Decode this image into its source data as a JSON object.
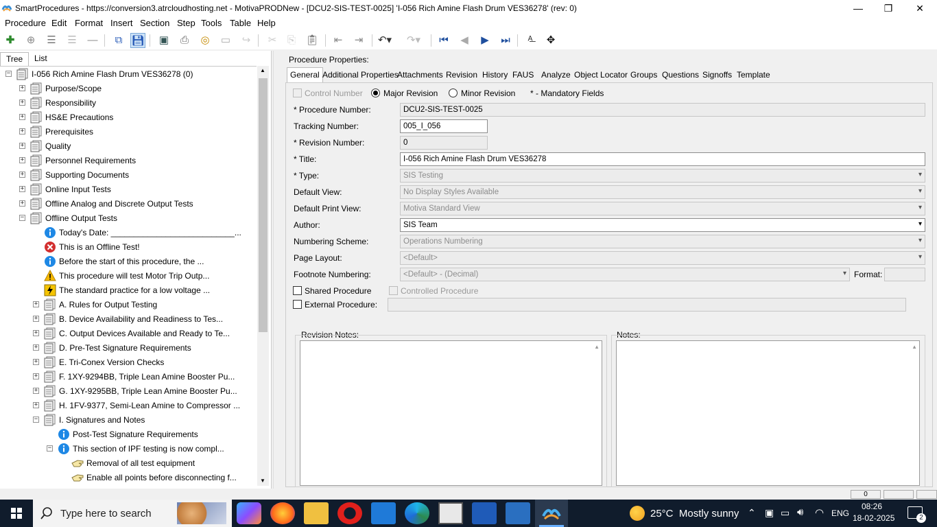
{
  "window": {
    "title": "SmartProcedures - https://conversion3.atrcloudhosting.net - MotivaPRODNew - [DCU2-SIS-TEST-0025] 'I-056 Rich Amine Flash Drum VES36278' (rev: 0)",
    "minimize": "—",
    "restore": "❐",
    "close": "✕"
  },
  "menu": [
    "Procedure",
    "Edit",
    "Format",
    "Insert",
    "Section",
    "Step",
    "Tools",
    "Table",
    "Help"
  ],
  "toolbar_icons": [
    "add-icon",
    "add-child-icon",
    "indent-icon",
    "outdent-icon",
    "remove-icon",
    "copy-file-icon",
    "save-icon",
    "monitor-icon",
    "print-icon",
    "globe-icon",
    "preview-icon",
    "redo-icon",
    "cut-icon",
    "copy-icon",
    "paste-icon",
    "indent-left-icon",
    "indent-right-icon",
    "undo-icon",
    "redo-icon",
    "first-icon",
    "prev-icon",
    "next-icon",
    "last-icon",
    "spell-icon",
    "move-icon"
  ],
  "left_tabs": [
    "Tree",
    "List"
  ],
  "tree": [
    {
      "label": "I-056 Rich Amine Flash Drum VES36278 (0)",
      "level": 0,
      "pm": "−",
      "icon": "doc-icon"
    },
    {
      "label": "Purpose/Scope",
      "level": 1,
      "pm": "+",
      "icon": "doc-icon"
    },
    {
      "label": "Responsibility",
      "level": 1,
      "pm": "+",
      "icon": "doc-icon"
    },
    {
      "label": "HS&E Precautions",
      "level": 1,
      "pm": "+",
      "icon": "doc-icon"
    },
    {
      "label": "Prerequisites",
      "level": 1,
      "pm": "+",
      "icon": "doc-icon"
    },
    {
      "label": "Quality",
      "level": 1,
      "pm": "+",
      "icon": "doc-icon"
    },
    {
      "label": "Personnel Requirements",
      "level": 1,
      "pm": "+",
      "icon": "doc-icon"
    },
    {
      "label": "Supporting Documents",
      "level": 1,
      "pm": "+",
      "icon": "doc-icon"
    },
    {
      "label": "Online Input Tests",
      "level": 1,
      "pm": "+",
      "icon": "doc-icon"
    },
    {
      "label": "Offline Analog and Discrete Output Tests",
      "level": 1,
      "pm": "+",
      "icon": "doc-icon"
    },
    {
      "label": "Offline Output Tests",
      "level": 1,
      "pm": "−",
      "icon": "doc-icon"
    },
    {
      "label": "Today's Date: ___________________________...",
      "level": 2,
      "pm": "",
      "icon": "info-icon"
    },
    {
      "label": "This is an Offline Test!",
      "level": 2,
      "pm": "",
      "icon": "error-icon"
    },
    {
      "label": "Before the start of this procedure, the ...",
      "level": 2,
      "pm": "",
      "icon": "info-icon"
    },
    {
      "label": "This procedure will test Motor Trip Outp...",
      "level": 2,
      "pm": "",
      "icon": "warning-icon"
    },
    {
      "label": "The standard practice for a low voltage ...",
      "level": 2,
      "pm": "",
      "icon": "electric-icon"
    },
    {
      "label": "A. Rules for Output Testing",
      "level": 2,
      "pm": "+",
      "icon": "doc-icon"
    },
    {
      "label": "B. Device Availability and Readiness to Tes...",
      "level": 2,
      "pm": "+",
      "icon": "doc-icon"
    },
    {
      "label": "C. Output Devices Available and Ready to Te...",
      "level": 2,
      "pm": "+",
      "icon": "doc-icon"
    },
    {
      "label": "D. Pre-Test Signature Requirements",
      "level": 2,
      "pm": "+",
      "icon": "doc-icon"
    },
    {
      "label": "E. Tri-Conex Version Checks",
      "level": 2,
      "pm": "+",
      "icon": "doc-icon"
    },
    {
      "label": "F. 1XY-9294BB, Triple Lean Amine Booster Pu...",
      "level": 2,
      "pm": "+",
      "icon": "doc-icon"
    },
    {
      "label": "G. 1XY-9295BB, Triple Lean Amine Booster Pu...",
      "level": 2,
      "pm": "+",
      "icon": "doc-icon"
    },
    {
      "label": "H. 1FV-9377, Semi-Lean Amine to Compressor ...",
      "level": 2,
      "pm": "+",
      "icon": "doc-icon"
    },
    {
      "label": "I. Signatures and Notes",
      "level": 2,
      "pm": "−",
      "icon": "doc-icon"
    },
    {
      "label": "Post-Test Signature Requirements",
      "level": 3,
      "pm": "",
      "icon": "info-icon"
    },
    {
      "label": "This section of IPF testing is now compl...",
      "level": 3,
      "pm": "−",
      "icon": "info-icon"
    },
    {
      "label": "Removal of all test equipment",
      "level": 4,
      "pm": "",
      "icon": "hand-icon"
    },
    {
      "label": "Enable all points before disconnecting f...",
      "level": 4,
      "pm": "",
      "icon": "hand-icon"
    }
  ],
  "properties": {
    "heading": "Procedure Properties:",
    "tabs": [
      "General",
      "Additional Properties",
      "Attachments",
      "Revision",
      "History",
      "FAUS",
      "Analyze",
      "Object Locator",
      "Groups",
      "Questions",
      "Signoffs",
      "Template"
    ],
    "control_number": "Control Number",
    "major_revision": "Major Revision",
    "minor_revision": "Minor Revision",
    "mandatory": "* - Mandatory Fields",
    "fields": {
      "procedure_number": {
        "label": "* Procedure Number:",
        "value": "DCU2-SIS-TEST-0025"
      },
      "tracking_number": {
        "label": "Tracking Number:",
        "value": "005_I_056"
      },
      "revision_number": {
        "label": "* Revision Number:",
        "value": "0"
      },
      "title": {
        "label": "* Title:",
        "value": "I-056 Rich Amine Flash Drum VES36278"
      },
      "type": {
        "label": "* Type:",
        "value": "SIS Testing"
      },
      "default_view": {
        "label": "Default View:",
        "value": "No Display Styles Available"
      },
      "default_print_view": {
        "label": "Default Print View:",
        "value": "Motiva Standard View"
      },
      "author": {
        "label": "Author:",
        "value": "SIS Team"
      },
      "numbering_scheme": {
        "label": "Numbering Scheme:",
        "value": "Operations Numbering"
      },
      "page_layout": {
        "label": "Page Layout:",
        "value": "<Default>"
      },
      "footnote_numbering": {
        "label": "Footnote Numbering:",
        "value": "<Default> - (Decimal)"
      },
      "format": {
        "label": "Format:",
        "value": ""
      }
    },
    "shared_procedure": "Shared Procedure",
    "controlled_procedure": "Controlled Procedure",
    "external_procedure": "External Procedure:",
    "revision_notes": "Revision Notes:",
    "notes": "Notes:"
  },
  "status": {
    "page": "0"
  },
  "taskbar": {
    "search_placeholder": "Type here to search",
    "weather": "25°C  Mostly sunny",
    "lang": "ENG",
    "time": "08:26",
    "date": "18-02-2025",
    "notifications": "2"
  },
  "colors": {
    "accent": "#2a5cb8",
    "taskbar": "#101c2c",
    "warning": "#f5b800",
    "error": "#d32f2f",
    "info": "#1e88e5"
  }
}
